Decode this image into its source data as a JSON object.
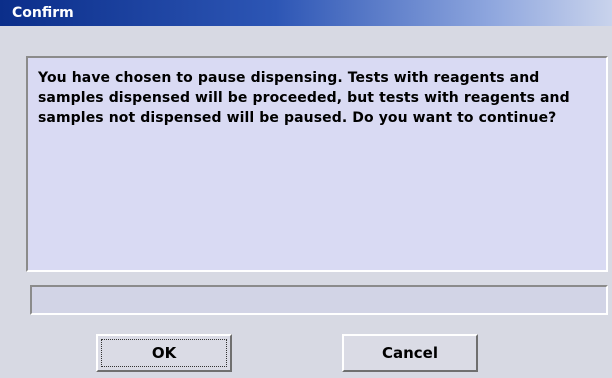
{
  "window": {
    "title": "Confirm"
  },
  "dialog": {
    "message": "You have chosen to pause dispensing. Tests with reagents and samples dispensed will be proceeded, but tests with reagents and samples not dispensed will be paused. Do you want to continue?",
    "status_text": ""
  },
  "buttons": {
    "ok_label": "OK",
    "cancel_label": "Cancel"
  },
  "colors": {
    "title_bar": "#0b2e8a",
    "dialog_background": "#d7d9e3",
    "message_background": "#d9daf3"
  }
}
